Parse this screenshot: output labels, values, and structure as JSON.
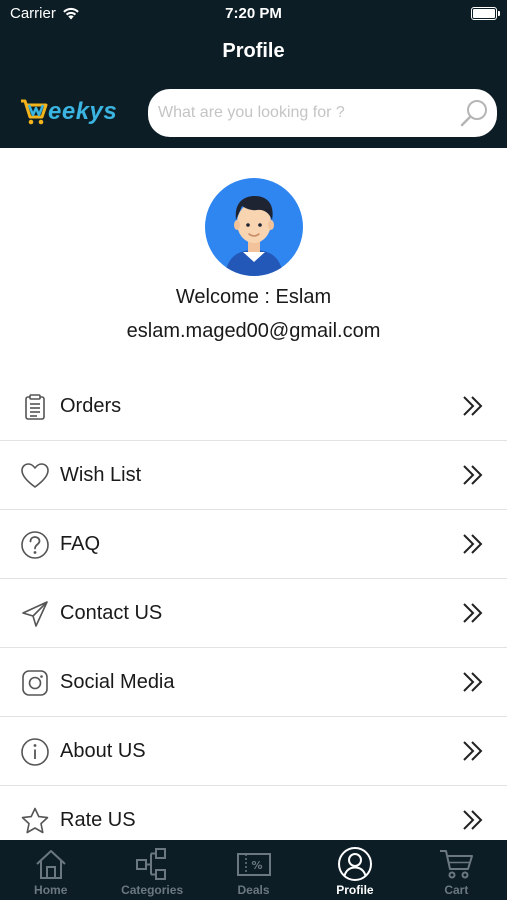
{
  "status": {
    "carrier": "Carrier",
    "time": "7:20 PM"
  },
  "header": {
    "title": "Profile"
  },
  "brand": {
    "name": "eekys"
  },
  "search": {
    "placeholder": "What are you looking for ?",
    "value": ""
  },
  "profile": {
    "welcome": "Welcome : Eslam",
    "email": "eslam.maged00@gmail.com"
  },
  "menu": [
    {
      "label": "Orders",
      "icon": "clipboard-icon"
    },
    {
      "label": "Wish List",
      "icon": "heart-icon"
    },
    {
      "label": "FAQ",
      "icon": "question-icon"
    },
    {
      "label": "Contact US",
      "icon": "paper-plane-icon"
    },
    {
      "label": "Social Media",
      "icon": "instagram-icon"
    },
    {
      "label": "About US",
      "icon": "info-icon"
    },
    {
      "label": "Rate US",
      "icon": "star-icon"
    }
  ],
  "tabs": [
    {
      "label": "Home",
      "icon": "home-icon",
      "active": false
    },
    {
      "label": "Categories",
      "icon": "categories-icon",
      "active": false
    },
    {
      "label": "Deals",
      "icon": "deals-icon",
      "active": false
    },
    {
      "label": "Profile",
      "icon": "profile-icon",
      "active": true
    },
    {
      "label": "Cart",
      "icon": "cart-icon",
      "active": false
    }
  ],
  "colors": {
    "navy": "#0d1d26",
    "brand_blue": "#3ab4e0",
    "brand_yellow": "#f2b31b",
    "avatar_bg": "#2f86f0",
    "inactive_tab": "#6b7880"
  }
}
